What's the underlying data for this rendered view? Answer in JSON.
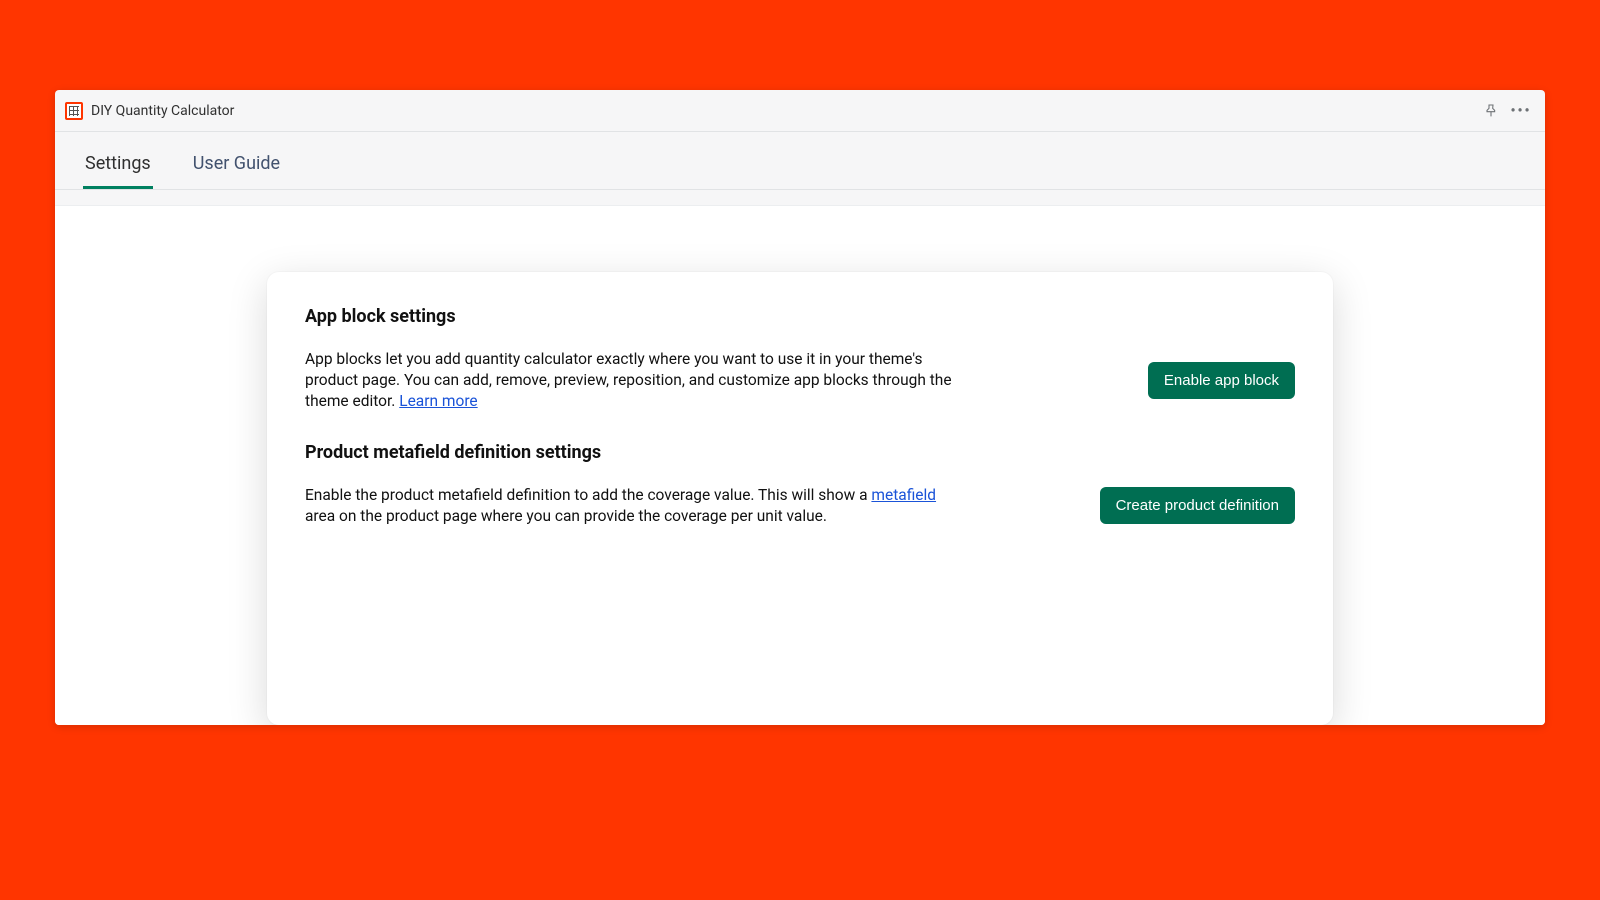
{
  "header": {
    "app_title": "DIY Quantity Calculator"
  },
  "tabs": {
    "settings": "Settings",
    "user_guide": "User Guide"
  },
  "card": {
    "section1": {
      "title": "App block settings",
      "desc_pre": "App blocks let you add quantity calculator exactly where you want to use it in your theme's product page. You can add, remove, preview, reposition, and customize app blocks through the theme editor. ",
      "learn_more": "Learn more",
      "button": "Enable app block"
    },
    "section2": {
      "title": "Product metafield definition settings",
      "desc_pre": "Enable the product metafield definition to add the coverage value. This will show a ",
      "metafield_link": "metafield",
      "desc_post": " area on the product page where you can provide the coverage per unit value.",
      "button": "Create product definition"
    }
  },
  "colors": {
    "accent": "#008060",
    "button": "#006e52",
    "link": "#1a53d8",
    "background": "#ff3500"
  }
}
